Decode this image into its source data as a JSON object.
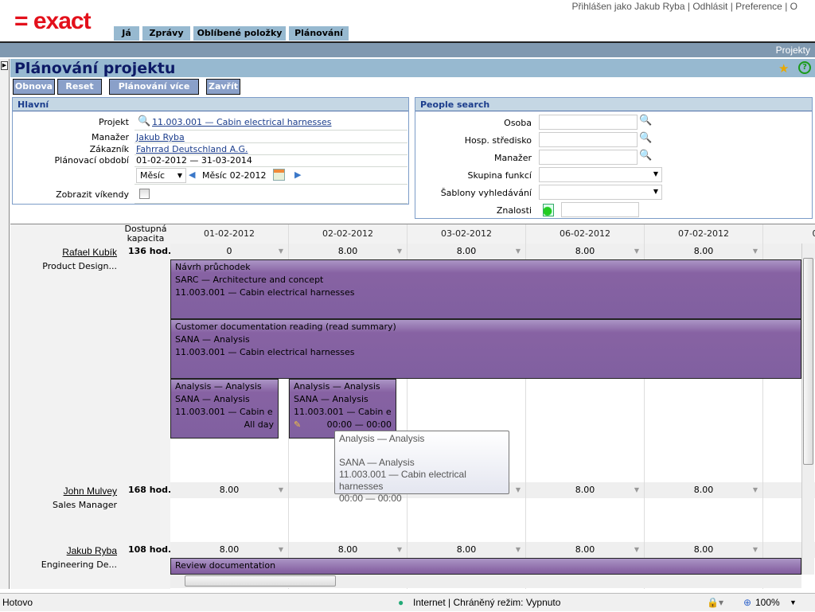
{
  "header": {
    "logo": "= exact",
    "tabs": [
      "Já",
      "Zprávy",
      "Oblíbené položky",
      "Plánování"
    ],
    "user_links": [
      "Přihlášen jako Jakub Ryba",
      "Odhlásit",
      "Preference",
      "O"
    ],
    "breadcrumb": "Projekty"
  },
  "page": {
    "title": "Plánování projektu",
    "buttons": {
      "refresh": "Obnova",
      "reset": "Reset",
      "multi": "Plánování více dnů",
      "close": "Zavřít"
    }
  },
  "main": {
    "heading": "Hlavní",
    "project_label": "Projekt",
    "project": "11.003.001 — Cabin electrical harnesses",
    "manager_label": "Manažer",
    "manager": "Jakub Ryba",
    "customer_label": "Zákazník",
    "customer": "Fahrrad Deutschland A.G.",
    "period_label": "Plánovací období",
    "period": "01-02-2012 — 31-03-2014",
    "view_select": "Měsíc",
    "month": "Měsíc 02-2012",
    "weekends_label": "Zobrazit víkendy"
  },
  "people": {
    "heading": "People search",
    "person": "Osoba",
    "cost_center": "Hosp. středisko",
    "manager": "Manažer",
    "function_group": "Skupina funkcí",
    "templates": "Šablony vyhledávání",
    "skills": "Znalosti"
  },
  "grid": {
    "capacity_header": "Dostupná kapacita",
    "dates": [
      "01-02-2012",
      "02-02-2012",
      "03-02-2012",
      "06-02-2012",
      "07-02-2012",
      "08-0"
    ],
    "people": [
      {
        "name": "Rafael Kubík",
        "role": "Product Design...",
        "capacity": "136 hod.",
        "hours": [
          "0",
          "8.00",
          "8.00",
          "8.00",
          "8.00"
        ]
      },
      {
        "name": "John Mulvey",
        "role": "Sales Manager",
        "capacity": "168 hod.",
        "hours": [
          "8.00",
          "",
          "",
          "8.00",
          "8.00"
        ]
      },
      {
        "name": "Jakub Ryba",
        "role": "Engineering De...",
        "capacity": "108 hod.",
        "hours": [
          "8.00",
          "8.00",
          "8.00",
          "8.00",
          "8.00"
        ]
      }
    ],
    "events": [
      {
        "l1": "Návrh průchodek",
        "l2": "SARC — Architecture and concept",
        "l3": "11.003.001 — Cabin electrical harnesses"
      },
      {
        "l1": "Customer documentation reading (read summary)",
        "l2": "SANA — Analysis",
        "l3": "11.003.001 — Cabin electrical harnesses"
      },
      {
        "l1": "Analysis — Analysis",
        "l2": "SANA — Analysis",
        "l3": "11.003.001 — Cabin e",
        "time": "All day"
      },
      {
        "l1": "Analysis — Analysis",
        "l2": "SANA — Analysis",
        "l3": "11.003.001 — Cabin e",
        "time": "00:00 — 00:00"
      },
      {
        "l1": "Review documentation"
      }
    ],
    "tooltip": {
      "l1": "Analysis — Analysis",
      "l2": "SANA — Analysis",
      "l3": "11.003.001 — Cabin electrical harnesses",
      "l4": "00:00 — 00:00"
    }
  },
  "statusbar": {
    "status": "Hotovo",
    "zone": "Internet | Chráněný režim: Vypnuto",
    "zoom": "100%"
  },
  "colors": {
    "brand": "#e3101b",
    "event": "#8060a0",
    "titlebar": "#97b9d0"
  }
}
